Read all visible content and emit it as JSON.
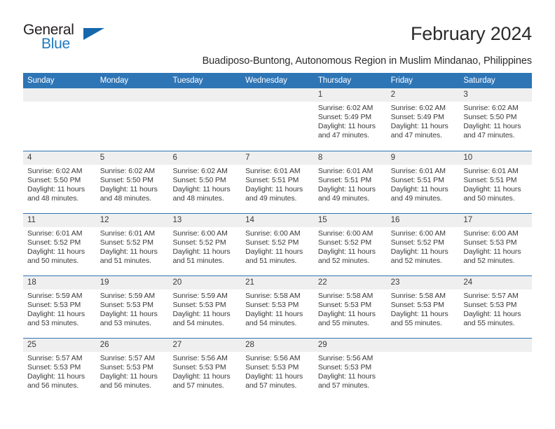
{
  "brand": {
    "name_part1": "General",
    "name_part2": "Blue",
    "triangle_icon": "triangle-icon",
    "accent_color": "#1f7ac0"
  },
  "header": {
    "title": "February 2024",
    "subtitle": "Buadiposo-Buntong, Autonomous Region in Muslim Mindanao, Philippines"
  },
  "calendar": {
    "header_color": "#2e75b6",
    "day_band_color": "#efefef",
    "weekdays": [
      "Sunday",
      "Monday",
      "Tuesday",
      "Wednesday",
      "Thursday",
      "Friday",
      "Saturday"
    ],
    "weeks": [
      [
        {
          "day": "",
          "empty": true
        },
        {
          "day": "",
          "empty": true
        },
        {
          "day": "",
          "empty": true
        },
        {
          "day": "",
          "empty": true
        },
        {
          "day": "1",
          "sunrise": "Sunrise: 6:02 AM",
          "sunset": "Sunset: 5:49 PM",
          "daylight_line1": "Daylight: 11 hours",
          "daylight_line2": "and 47 minutes."
        },
        {
          "day": "2",
          "sunrise": "Sunrise: 6:02 AM",
          "sunset": "Sunset: 5:49 PM",
          "daylight_line1": "Daylight: 11 hours",
          "daylight_line2": "and 47 minutes."
        },
        {
          "day": "3",
          "sunrise": "Sunrise: 6:02 AM",
          "sunset": "Sunset: 5:50 PM",
          "daylight_line1": "Daylight: 11 hours",
          "daylight_line2": "and 47 minutes."
        }
      ],
      [
        {
          "day": "4",
          "sunrise": "Sunrise: 6:02 AM",
          "sunset": "Sunset: 5:50 PM",
          "daylight_line1": "Daylight: 11 hours",
          "daylight_line2": "and 48 minutes."
        },
        {
          "day": "5",
          "sunrise": "Sunrise: 6:02 AM",
          "sunset": "Sunset: 5:50 PM",
          "daylight_line1": "Daylight: 11 hours",
          "daylight_line2": "and 48 minutes."
        },
        {
          "day": "6",
          "sunrise": "Sunrise: 6:02 AM",
          "sunset": "Sunset: 5:50 PM",
          "daylight_line1": "Daylight: 11 hours",
          "daylight_line2": "and 48 minutes."
        },
        {
          "day": "7",
          "sunrise": "Sunrise: 6:01 AM",
          "sunset": "Sunset: 5:51 PM",
          "daylight_line1": "Daylight: 11 hours",
          "daylight_line2": "and 49 minutes."
        },
        {
          "day": "8",
          "sunrise": "Sunrise: 6:01 AM",
          "sunset": "Sunset: 5:51 PM",
          "daylight_line1": "Daylight: 11 hours",
          "daylight_line2": "and 49 minutes."
        },
        {
          "day": "9",
          "sunrise": "Sunrise: 6:01 AM",
          "sunset": "Sunset: 5:51 PM",
          "daylight_line1": "Daylight: 11 hours",
          "daylight_line2": "and 49 minutes."
        },
        {
          "day": "10",
          "sunrise": "Sunrise: 6:01 AM",
          "sunset": "Sunset: 5:51 PM",
          "daylight_line1": "Daylight: 11 hours",
          "daylight_line2": "and 50 minutes."
        }
      ],
      [
        {
          "day": "11",
          "sunrise": "Sunrise: 6:01 AM",
          "sunset": "Sunset: 5:52 PM",
          "daylight_line1": "Daylight: 11 hours",
          "daylight_line2": "and 50 minutes."
        },
        {
          "day": "12",
          "sunrise": "Sunrise: 6:01 AM",
          "sunset": "Sunset: 5:52 PM",
          "daylight_line1": "Daylight: 11 hours",
          "daylight_line2": "and 51 minutes."
        },
        {
          "day": "13",
          "sunrise": "Sunrise: 6:00 AM",
          "sunset": "Sunset: 5:52 PM",
          "daylight_line1": "Daylight: 11 hours",
          "daylight_line2": "and 51 minutes."
        },
        {
          "day": "14",
          "sunrise": "Sunrise: 6:00 AM",
          "sunset": "Sunset: 5:52 PM",
          "daylight_line1": "Daylight: 11 hours",
          "daylight_line2": "and 51 minutes."
        },
        {
          "day": "15",
          "sunrise": "Sunrise: 6:00 AM",
          "sunset": "Sunset: 5:52 PM",
          "daylight_line1": "Daylight: 11 hours",
          "daylight_line2": "and 52 minutes."
        },
        {
          "day": "16",
          "sunrise": "Sunrise: 6:00 AM",
          "sunset": "Sunset: 5:52 PM",
          "daylight_line1": "Daylight: 11 hours",
          "daylight_line2": "and 52 minutes."
        },
        {
          "day": "17",
          "sunrise": "Sunrise: 6:00 AM",
          "sunset": "Sunset: 5:53 PM",
          "daylight_line1": "Daylight: 11 hours",
          "daylight_line2": "and 52 minutes."
        }
      ],
      [
        {
          "day": "18",
          "sunrise": "Sunrise: 5:59 AM",
          "sunset": "Sunset: 5:53 PM",
          "daylight_line1": "Daylight: 11 hours",
          "daylight_line2": "and 53 minutes."
        },
        {
          "day": "19",
          "sunrise": "Sunrise: 5:59 AM",
          "sunset": "Sunset: 5:53 PM",
          "daylight_line1": "Daylight: 11 hours",
          "daylight_line2": "and 53 minutes."
        },
        {
          "day": "20",
          "sunrise": "Sunrise: 5:59 AM",
          "sunset": "Sunset: 5:53 PM",
          "daylight_line1": "Daylight: 11 hours",
          "daylight_line2": "and 54 minutes."
        },
        {
          "day": "21",
          "sunrise": "Sunrise: 5:58 AM",
          "sunset": "Sunset: 5:53 PM",
          "daylight_line1": "Daylight: 11 hours",
          "daylight_line2": "and 54 minutes."
        },
        {
          "day": "22",
          "sunrise": "Sunrise: 5:58 AM",
          "sunset": "Sunset: 5:53 PM",
          "daylight_line1": "Daylight: 11 hours",
          "daylight_line2": "and 55 minutes."
        },
        {
          "day": "23",
          "sunrise": "Sunrise: 5:58 AM",
          "sunset": "Sunset: 5:53 PM",
          "daylight_line1": "Daylight: 11 hours",
          "daylight_line2": "and 55 minutes."
        },
        {
          "day": "24",
          "sunrise": "Sunrise: 5:57 AM",
          "sunset": "Sunset: 5:53 PM",
          "daylight_line1": "Daylight: 11 hours",
          "daylight_line2": "and 55 minutes."
        }
      ],
      [
        {
          "day": "25",
          "sunrise": "Sunrise: 5:57 AM",
          "sunset": "Sunset: 5:53 PM",
          "daylight_line1": "Daylight: 11 hours",
          "daylight_line2": "and 56 minutes."
        },
        {
          "day": "26",
          "sunrise": "Sunrise: 5:57 AM",
          "sunset": "Sunset: 5:53 PM",
          "daylight_line1": "Daylight: 11 hours",
          "daylight_line2": "and 56 minutes."
        },
        {
          "day": "27",
          "sunrise": "Sunrise: 5:56 AM",
          "sunset": "Sunset: 5:53 PM",
          "daylight_line1": "Daylight: 11 hours",
          "daylight_line2": "and 57 minutes."
        },
        {
          "day": "28",
          "sunrise": "Sunrise: 5:56 AM",
          "sunset": "Sunset: 5:53 PM",
          "daylight_line1": "Daylight: 11 hours",
          "daylight_line2": "and 57 minutes."
        },
        {
          "day": "29",
          "sunrise": "Sunrise: 5:56 AM",
          "sunset": "Sunset: 5:53 PM",
          "daylight_line1": "Daylight: 11 hours",
          "daylight_line2": "and 57 minutes."
        },
        {
          "day": "",
          "empty": true
        },
        {
          "day": "",
          "empty": true
        }
      ]
    ]
  }
}
